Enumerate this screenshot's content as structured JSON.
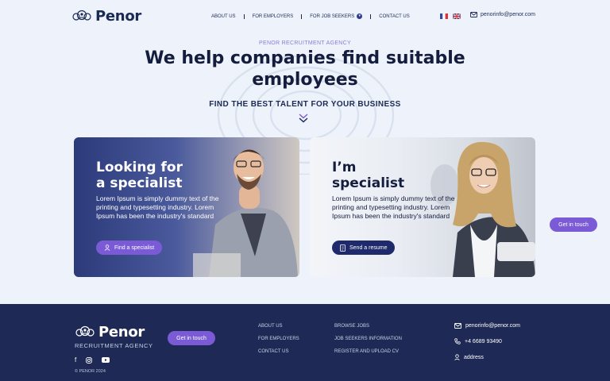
{
  "brand": {
    "name": "Penor",
    "tagline": "RECRUITMENT AGENCY"
  },
  "nav": {
    "items": [
      {
        "label": "ABOUT US"
      },
      {
        "label": "FOR EMPLOYERS"
      },
      {
        "label": "FOR JOB SEEKERS"
      },
      {
        "label": "CONTACT US"
      }
    ],
    "languages": [
      "fr-flag-icon",
      "uk-flag-icon"
    ],
    "email": "penorinfo@penor.com"
  },
  "hero": {
    "eyebrow": "PENOR RECRUITMENT AGENCY",
    "title": "We help companies find suitable employees",
    "subtitle": "FIND THE BEST TALENT FOR YOUR BUSINESS"
  },
  "cards": {
    "employer": {
      "title_line1": "Looking for",
      "title_line2": "a specialist",
      "text": "Lorem Ipsum is simply dummy text of the printing and typesetting industry. Lorem Ipsum has been the industry's standard",
      "button": "Find a specialist"
    },
    "specialist": {
      "title_line1": "I’m",
      "title_line2": "specialist",
      "text": "Lorem Ipsum is simply dummy text of the printing and typesetting industry. Lorem Ipsum has been the industry's standard",
      "button": "Send a resume"
    }
  },
  "float_button": "Get in touch",
  "footer": {
    "button": "Get in touch",
    "col1": [
      "ABOUT US",
      "FOR EMPLOYERS",
      "CONTACT US"
    ],
    "col2": [
      "BROWSE JOBS",
      "JOB SEEKERS INFORMATION",
      "REGISTER AND UPLOAD CV"
    ],
    "contact": {
      "email": "penorinfo@penor.com",
      "phone": "+4 6689 93490",
      "address": "address"
    },
    "social": [
      "facebook-icon",
      "instagram-icon",
      "youtube-icon"
    ],
    "copyright": "© PENOR 2024"
  },
  "colors": {
    "navy": "#1e2a55",
    "accent": "#7b5ad6",
    "background": "#eef3fb"
  }
}
